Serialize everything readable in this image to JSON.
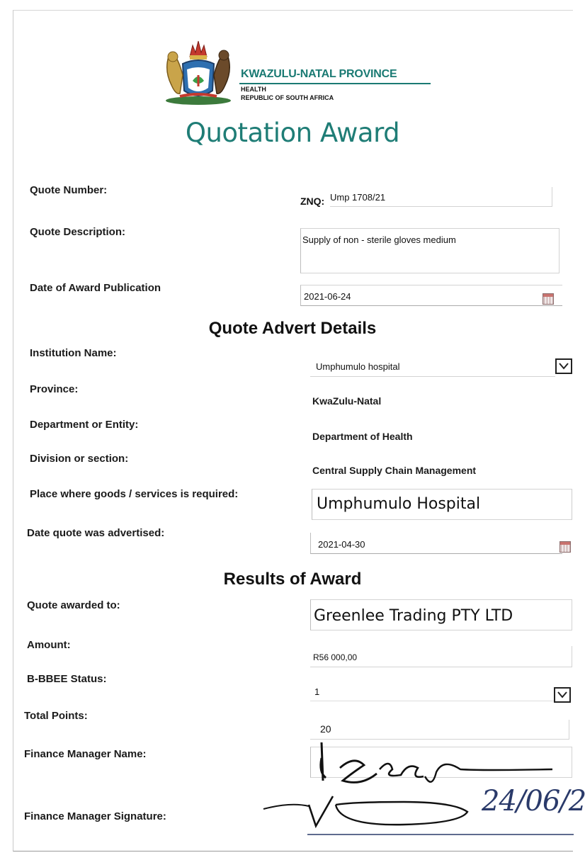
{
  "header": {
    "province": "KWAZULU-NATAL PROVINCE",
    "department": "HEALTH",
    "country": "REPUBLIC OF SOUTH AFRICA",
    "title": "Quotation Award"
  },
  "quote": {
    "number_label": "Quote Number:",
    "number_prefix": "ZNQ:",
    "number_value": "Ump 1708/21",
    "description_label": "Quote Description:",
    "description_value": "Supply of non - sterile gloves medium",
    "publication_label": "Date of Award Publication",
    "publication_value": "2021-06-24"
  },
  "advert": {
    "title": "Quote Advert Details",
    "institution_label": "Institution Name:",
    "institution_value": "Umphumulo hospital",
    "province_label": "Province:",
    "province_value": "KwaZulu-Natal",
    "department_label": "Department or Entity:",
    "department_value": "Department of Health",
    "division_label": "Division or section:",
    "division_value": "Central Supply Chain Management",
    "place_label": "Place where goods /  services is required:",
    "place_value": "Umphumulo Hospital",
    "advertised_label": "Date quote was advertised:",
    "advertised_value": "2021-04-30"
  },
  "results": {
    "title": "Results of Award",
    "awarded_label": "Quote awarded to:",
    "awarded_value": "Greenlee Trading PTY LTD",
    "amount_label": "Amount:",
    "amount_value": "R56 000,00",
    "bbbee_label": "B-BBEE Status:",
    "bbbee_value": "1",
    "points_label": "Total Points:",
    "points_value": "20",
    "manager_label": "Finance Manager Name:",
    "signature_label": "Finance Manager Signature:",
    "signature_date": "24/06/2"
  },
  "icons": {
    "calendar": "calendar-icon",
    "dropdown": "chevron-down-icon"
  },
  "colors": {
    "brand_teal": "#1f7d76"
  }
}
